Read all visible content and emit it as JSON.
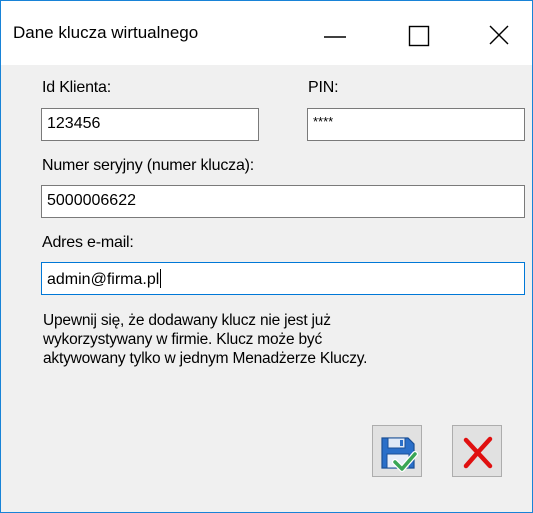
{
  "window": {
    "title": "Dane klucza wirtualnego",
    "controls": {
      "minimize_icon": "minimize-icon",
      "maximize_icon": "maximize-icon",
      "close_icon": "close-icon"
    }
  },
  "form": {
    "client_id": {
      "label": "Id Klienta:",
      "value": "123456"
    },
    "pin": {
      "label": "PIN:",
      "value": "****"
    },
    "serial": {
      "label": "Numer seryjny (numer klucza):",
      "value": "5000006622"
    },
    "email": {
      "label": "Adres e-mail:",
      "value": "admin@firma.pl"
    }
  },
  "info_lines": [
    "Upewnij się, że dodawany klucz nie jest już",
    "wykorzystywany w firmie. Klucz może być",
    "aktywowany tylko w jednym Menadżerze Kluczy."
  ],
  "actions": {
    "save_icon": "save-check-icon",
    "cancel_icon": "cancel-x-icon"
  },
  "colors": {
    "accent": "#0078d7",
    "window_border": "#1883d7",
    "cancel_red": "#e01010",
    "save_blue": "#2a6fc9",
    "save_check": "#3aa655"
  }
}
